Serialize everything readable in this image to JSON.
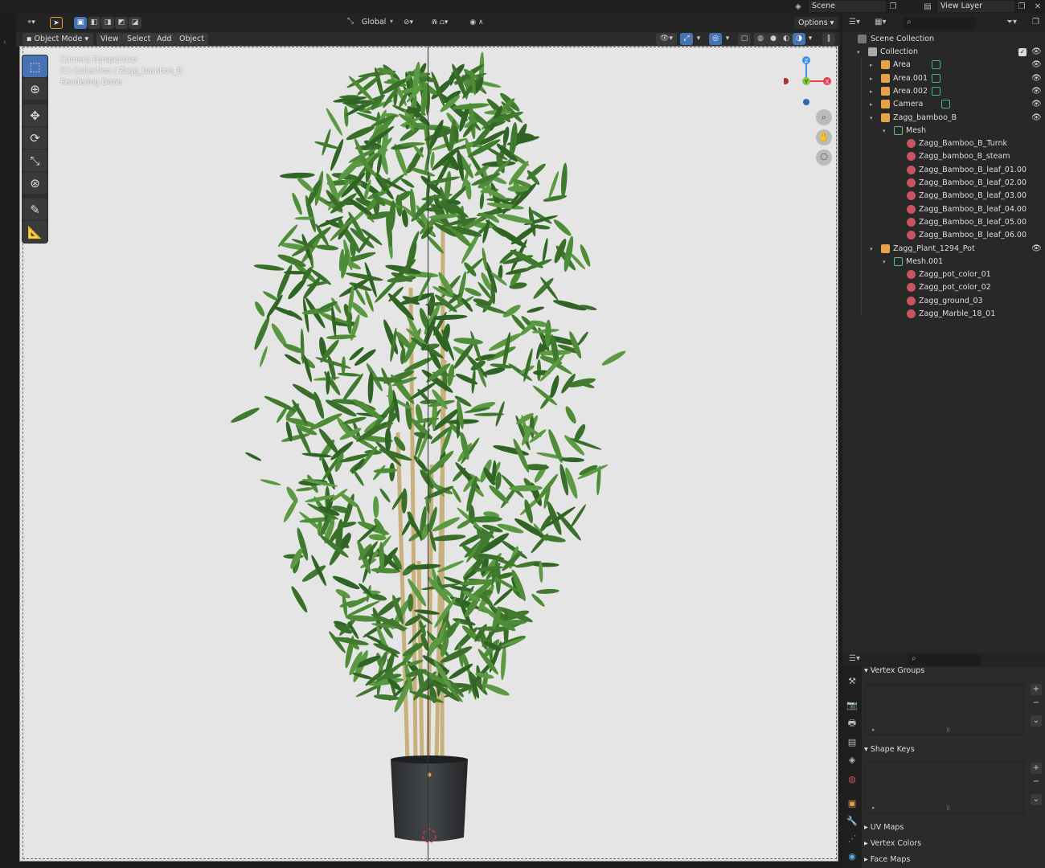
{
  "topbar": {
    "scene": "Scene",
    "view_layer": "View Layer"
  },
  "viewport_header": {
    "orientation": "Global",
    "options": "Options"
  },
  "header_menu": {
    "mode": "Object Mode",
    "view": "View",
    "select": "Select",
    "add": "Add",
    "object": "Object"
  },
  "overlay": {
    "line1": "Camera Perspective",
    "line2": "(1) Collection | Zagg_bamboo_B",
    "line3": "Rendering Done"
  },
  "gizmo": {
    "z": "Z",
    "y": "Y",
    "x": "X"
  },
  "outliner": {
    "scene_collection": "Scene Collection",
    "rows": [
      {
        "label": "Collection",
        "depth": 0,
        "type": "collection",
        "eye": true
      },
      {
        "label": "Area",
        "depth": 1,
        "type": "light",
        "eye": true
      },
      {
        "label": "Area.001",
        "depth": 1,
        "type": "light",
        "eye": true
      },
      {
        "label": "Area.002",
        "depth": 1,
        "type": "light",
        "eye": true
      },
      {
        "label": "Camera",
        "depth": 1,
        "type": "camera",
        "eye": true
      },
      {
        "label": "Zagg_bamboo_B",
        "depth": 1,
        "type": "object",
        "eye": true
      },
      {
        "label": "Mesh",
        "depth": 2,
        "type": "mesh",
        "eye": false
      },
      {
        "label": "Zagg_Bamboo_B_Turnk",
        "depth": 3,
        "type": "material",
        "eye": false
      },
      {
        "label": "Zagg_bamboo_B_steam",
        "depth": 3,
        "type": "material",
        "eye": false
      },
      {
        "label": "Zagg_Bamboo_B_leaf_01.00",
        "depth": 3,
        "type": "material",
        "eye": false
      },
      {
        "label": "Zagg_Bamboo_B_leaf_02.00",
        "depth": 3,
        "type": "material",
        "eye": false
      },
      {
        "label": "Zagg_Bamboo_B_leaf_03.00",
        "depth": 3,
        "type": "material",
        "eye": false
      },
      {
        "label": "Zagg_Bamboo_B_leaf_04.00",
        "depth": 3,
        "type": "material",
        "eye": false
      },
      {
        "label": "Zagg_Bamboo_B_leaf_05.00",
        "depth": 3,
        "type": "material",
        "eye": false
      },
      {
        "label": "Zagg_Bamboo_B_leaf_06.00",
        "depth": 3,
        "type": "material",
        "eye": false
      },
      {
        "label": "Zagg_Plant_1294_Pot",
        "depth": 1,
        "type": "object",
        "eye": true
      },
      {
        "label": "Mesh.001",
        "depth": 2,
        "type": "mesh",
        "eye": false
      },
      {
        "label": "Zagg_pot_color_01",
        "depth": 3,
        "type": "material",
        "eye": false
      },
      {
        "label": "Zagg_pot_color_02",
        "depth": 3,
        "type": "material",
        "eye": false
      },
      {
        "label": "Zagg_ground_03",
        "depth": 3,
        "type": "material",
        "eye": false
      },
      {
        "label": "Zagg_Marble_18_01",
        "depth": 3,
        "type": "material",
        "eye": false
      }
    ]
  },
  "properties": {
    "vertex_groups": "Vertex Groups",
    "shape_keys": "Shape Keys",
    "uv_maps": "UV Maps",
    "vertex_colors": "Vertex Colors",
    "face_maps": "Face Maps"
  },
  "colors": {
    "accent": "#4772b3",
    "material": "#c9535f",
    "object": "#e8a34a",
    "mesh": "#5cc48a",
    "axis_x": "#e5404e",
    "axis_y": "#83c93a",
    "axis_z": "#3f8fe8"
  }
}
